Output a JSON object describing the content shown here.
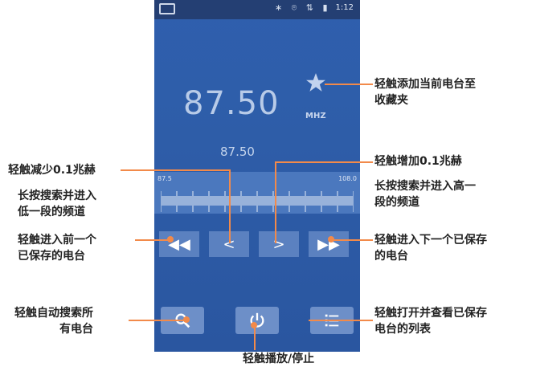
{
  "status_bar": {
    "time": "1:12",
    "icons_text": "∗ ⌾ ⇅ ▮"
  },
  "player": {
    "frequency": "87.50",
    "unit": "MHZ",
    "frequency_secondary": "87.50",
    "dial_min": "87.5",
    "dial_max": "108.0"
  },
  "buttons": {
    "prev_saved": "◀◀",
    "step_down": "<",
    "step_up": ">",
    "next_saved": "▶▶"
  },
  "bottom_buttons": [
    "search-icon",
    "power-icon",
    "list-icon"
  ],
  "callouts": {
    "favorite": "轻触添加当前电台至\n收藏夹",
    "step_down": "轻触减少0.1兆赫",
    "step_down_long": "长按搜索并进入\n低一段的频道",
    "step_up": "轻触增加0.1兆赫",
    "step_up_long": "长按搜索并进入高一\n段的频道",
    "prev_saved": "轻触进入前一个\n已保存的电台",
    "next_saved": "轻触进入下一个已保存\n的电台",
    "auto_search": "轻触自动搜索所\n有电台",
    "open_list": "轻触打开并查看已保存\n电台的列表",
    "play_stop": "轻触播放/停止"
  },
  "colors": {
    "accent": "#f28a4a",
    "phone_bg": "#2f5fae"
  }
}
